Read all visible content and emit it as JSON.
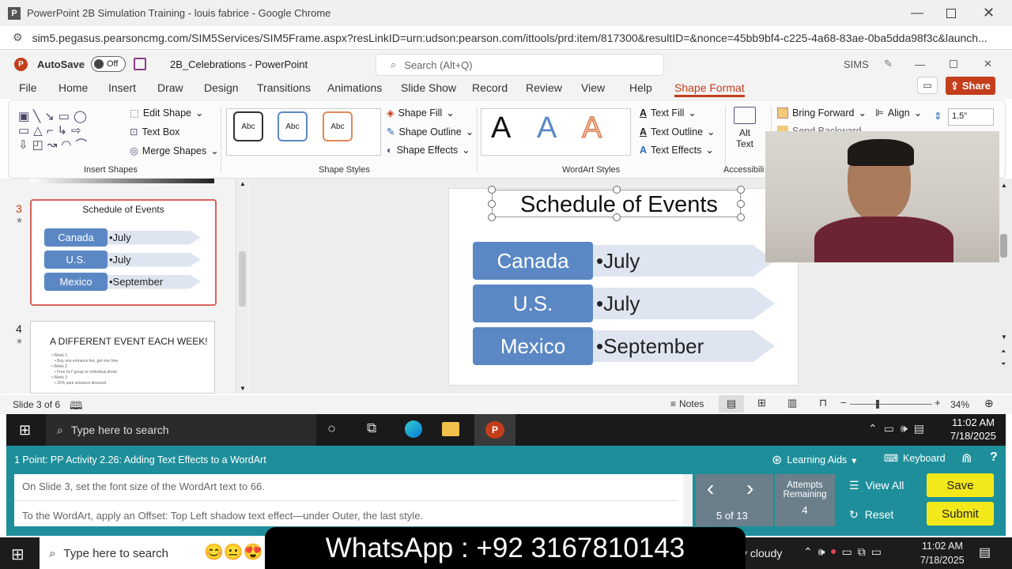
{
  "browser": {
    "title": "PowerPoint 2B Simulation Training - louis fabrice - Google Chrome",
    "url": "sim5.pegasus.pearsoncmg.com/SIM5Services/SIM5Frame.aspx?resLinkID=urn:udson:pearson.com/ittools/prd:item/817300&resultID=&nonce=45bb9bf4-c225-4a68-83ae-0ba5dda98f3c&launch..."
  },
  "ppt": {
    "autosave_label": "AutoSave",
    "autosave_state": "Off",
    "doc_title": "2B_Celebrations - PowerPoint",
    "search_placeholder": "Search (Alt+Q)",
    "user": "SIMS",
    "share_label": "Share",
    "menu": [
      "File",
      "Home",
      "Insert",
      "Draw",
      "Design",
      "Transitions",
      "Animations",
      "Slide Show",
      "Record",
      "Review",
      "View",
      "Help",
      "Shape Format"
    ],
    "active_menu": "Shape Format"
  },
  "ribbon": {
    "edit_shape": "Edit Shape",
    "text_box": "Text Box",
    "merge_shapes": "Merge Shapes",
    "insert_shapes_label": "Insert Shapes",
    "abc": [
      "Abc",
      "Abc",
      "Abc"
    ],
    "shape_fill": "Shape Fill",
    "shape_outline": "Shape Outline",
    "shape_effects": "Shape Effects",
    "shape_styles_label": "Shape Styles",
    "wordart_letters": [
      "A",
      "A",
      "A"
    ],
    "text_fill": "Text Fill",
    "text_outline": "Text Outline",
    "text_effects": "Text Effects",
    "wordart_label": "WordArt Styles",
    "alt_text": "Alt Text",
    "accessibility_label": "Accessibili",
    "bring_forward": "Bring Forward",
    "send_backward": "Send Backward",
    "align": "Align",
    "height_value": "1.5\""
  },
  "thumbs": {
    "slide3_num": "3",
    "slide3_title": "Schedule of Events",
    "slide4_num": "4",
    "slide4_title": "A DIFFERENT EVENT EACH WEEK!",
    "slide4_lines": [
      "• Week 1",
      "• Buy one entrance fee, get one free",
      "• Week 2",
      "• Free 5x7 group or individual photo",
      "• Week 3",
      "• 25% park entrance discount"
    ]
  },
  "slide": {
    "title": "Schedule of Events",
    "rows": [
      {
        "label": "Canada",
        "value": "•July"
      },
      {
        "label": "U.S.",
        "value": "•July"
      },
      {
        "label": "Mexico",
        "value": "•September"
      }
    ]
  },
  "status": {
    "slide_count": "Slide 3 of 6",
    "notes": "Notes",
    "zoom": "34%"
  },
  "vm_taskbar": {
    "search_placeholder": "Type here to search",
    "time": "11:02 AM",
    "date": "7/18/2025"
  },
  "task": {
    "title": "1 Point: PP Activity 2.26: Adding Text Effects to a WordArt",
    "learning_aids": "Learning Aids",
    "keyboard": "Keyboard",
    "instruction1": "On Slide 3, set the font size of the WordArt text to 66.",
    "instruction2": "To the WordArt, apply an Offset: Top Left shadow text effect—under Outer, the last style.",
    "progress": "5 of 13",
    "attempts_label": "Attempts Remaining",
    "attempts": "4",
    "view_all": "View All",
    "reset": "Reset",
    "save": "Save",
    "submit": "Submit"
  },
  "win_taskbar": {
    "search_placeholder": "Type here to search",
    "weather": "y cloudy",
    "time": "11:02 AM",
    "date": "7/18/2025"
  },
  "overlay": {
    "whatsapp": "WhatsApp : +92 3167810143"
  },
  "colors": {
    "accent_red": "#c43e1c",
    "task_teal": "#1e8f9a",
    "shape_blue": "#5b88c4",
    "yellow": "#f3e81a"
  }
}
